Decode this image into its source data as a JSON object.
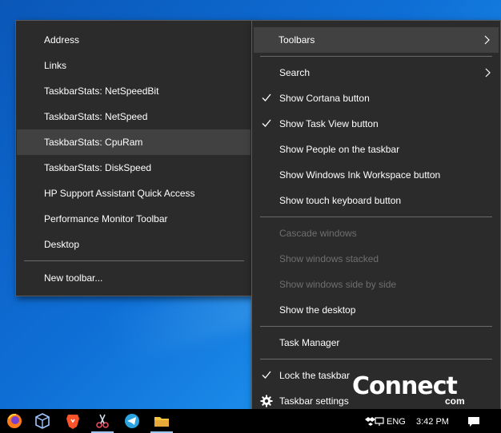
{
  "toolbars_submenu": {
    "items": [
      {
        "label": "Address"
      },
      {
        "label": "Links"
      },
      {
        "label": "TaskbarStats: NetSpeedBit"
      },
      {
        "label": "TaskbarStats: NetSpeed"
      },
      {
        "label": "TaskbarStats: CpuRam",
        "highlighted": true
      },
      {
        "label": "TaskbarStats: DiskSpeed"
      },
      {
        "label": "HP Support Assistant Quick Access"
      },
      {
        "label": "Performance Monitor Toolbar"
      },
      {
        "label": "Desktop"
      },
      {
        "label": "New toolbar..."
      }
    ]
  },
  "taskbar_menu": {
    "items": [
      {
        "label": "Toolbars",
        "submenu": true,
        "highlighted": true
      },
      {
        "label": "Search",
        "submenu": true
      },
      {
        "label": "Show Cortana button",
        "checked": true
      },
      {
        "label": "Show Task View button",
        "checked": true
      },
      {
        "label": "Show People on the taskbar"
      },
      {
        "label": "Show Windows Ink Workspace button"
      },
      {
        "label": "Show touch keyboard button"
      },
      {
        "label": "Cascade windows",
        "disabled": true
      },
      {
        "label": "Show windows stacked",
        "disabled": true
      },
      {
        "label": "Show windows side by side",
        "disabled": true
      },
      {
        "label": "Show the desktop"
      },
      {
        "label": "Task Manager"
      },
      {
        "label": "Lock the taskbar",
        "checked": true
      },
      {
        "label": "Taskbar settings",
        "icon": "gear-icon"
      }
    ]
  },
  "taskbar": {
    "pinned_icons": [
      "firefox-icon",
      "virtualbox-icon",
      "brave-icon",
      "snipping-tool-icon",
      "telegram-icon",
      "file-explorer-icon"
    ],
    "tray": {
      "language": "ENG",
      "time": "3:42 PM"
    }
  },
  "watermark": {
    "text": "Connect",
    "suffix": "com"
  },
  "colors": {
    "menu_bg": "#2b2b2b",
    "highlight": "#414141",
    "disabled_text": "#6f6f6f",
    "desktop_blue": "#0f6fd6"
  }
}
